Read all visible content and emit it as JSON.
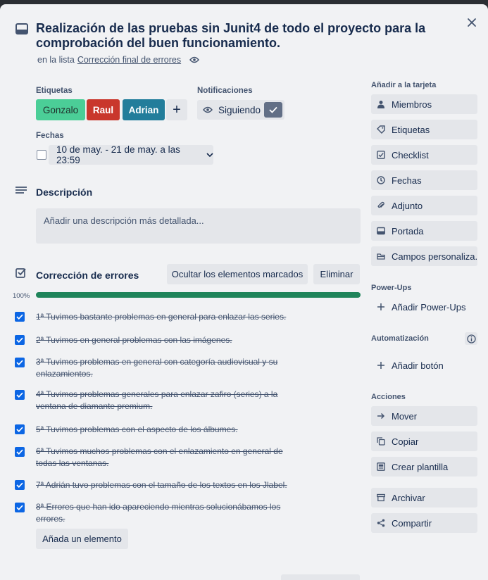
{
  "card": {
    "title": "Realización de las pruebas sin Junit4 de todo el proyecto para la comprobación del buen funcionamiento.",
    "in_list_prefix": "en la lista",
    "list_name": "Corrección final de errores"
  },
  "labels": {
    "heading": "Etiquetas",
    "items": [
      {
        "text": "Gonzalo",
        "color": "#4bce97"
      },
      {
        "text": "Raul",
        "color": "#c9372c"
      },
      {
        "text": "Adrian",
        "color": "#227d9b"
      }
    ],
    "add_symbol": "+"
  },
  "notifications": {
    "heading": "Notificaciones",
    "watch_label": "Siguiendo"
  },
  "dates": {
    "heading": "Fechas",
    "value": "10 de may. - 21 de may. a las 23:59"
  },
  "description": {
    "heading": "Descripción",
    "placeholder": "Añadir una descripción más detallada..."
  },
  "checklist": {
    "heading": "Corrección de errores",
    "hide_button": "Ocultar los elementos marcados",
    "delete_button": "Eliminar",
    "progress_label": "100%",
    "progress_fraction": 1.0,
    "items": [
      "1ª Tuvimos bastante problemas en general para enlazar las series.",
      "2ª Tuvimos en general problemas con las imágenes.",
      "3ª Tuvimos problemas en general con categoría audiovisual y su enlazamientos.",
      "4ª Tuvimos problemas generales para enlazar zafiro (series) a la ventana de diamante premium.",
      "5ª Tuvimos problemas con el aspecto de los álbumes.",
      "6ª Tuvimos muchos problemas con el enlazamiento en general de todas las ventanas.",
      "7ª Adrián tuvo problemas con el tamaño de los textos en los Jlabel.",
      "8ª Errores que han ido apareciendo mientras solucionábamos los errores."
    ],
    "add_item_button": "Añada un elemento"
  },
  "sidebar": {
    "add_to_card_heading": "Añadir a la tarjeta",
    "add_to_card": [
      {
        "label": "Miembros",
        "icon": "person-icon"
      },
      {
        "label": "Etiquetas",
        "icon": "tag-icon"
      },
      {
        "label": "Checklist",
        "icon": "checkbox-icon"
      },
      {
        "label": "Fechas",
        "icon": "clock-icon"
      },
      {
        "label": "Adjunto",
        "icon": "paperclip-icon"
      },
      {
        "label": "Portada",
        "icon": "card-cover-icon"
      },
      {
        "label": "Campos personaliza...",
        "icon": "custom-fields-icon"
      }
    ],
    "powerups_heading": "Power-Ups",
    "add_powerups": "Añadir Power-Ups",
    "automation_heading": "Automatización",
    "add_button": "Añadir botón",
    "actions_heading": "Acciones",
    "actions": [
      {
        "label": "Mover",
        "icon": "arrow-right-icon"
      },
      {
        "label": "Copiar",
        "icon": "copy-icon"
      },
      {
        "label": "Crear plantilla",
        "icon": "template-icon"
      },
      {
        "label": "Archivar",
        "icon": "archive-icon"
      },
      {
        "label": "Compartir",
        "icon": "share-icon"
      }
    ]
  },
  "colors": {
    "accent_blue": "#0c66e4",
    "progress_green": "#1f845a",
    "watch_check_bg": "#626f86"
  }
}
